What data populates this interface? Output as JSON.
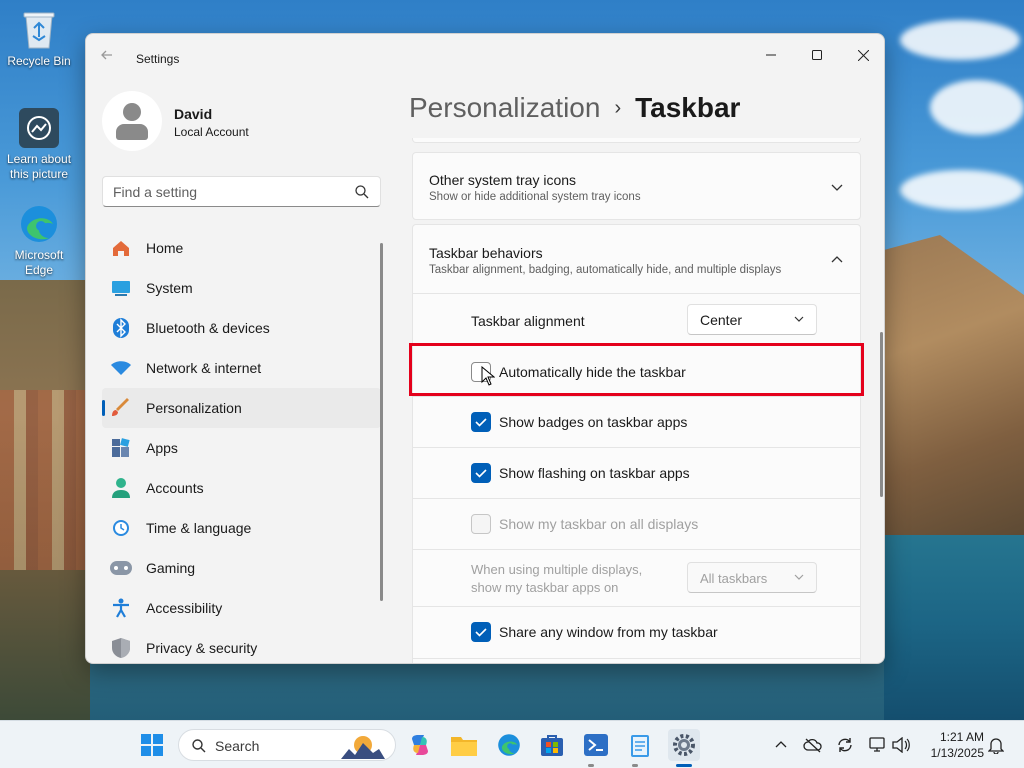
{
  "desktop": {
    "icons": [
      {
        "label": "Recycle Bin"
      },
      {
        "label": "Learn about this picture"
      },
      {
        "label": "Microsoft Edge"
      }
    ]
  },
  "window": {
    "title": "Settings",
    "profile": {
      "name": "David",
      "account": "Local Account"
    },
    "search": {
      "placeholder": "Find a setting"
    },
    "nav": [
      {
        "label": "Home",
        "icon": "home-icon"
      },
      {
        "label": "System",
        "icon": "system-icon"
      },
      {
        "label": "Bluetooth & devices",
        "icon": "bluetooth-icon"
      },
      {
        "label": "Network & internet",
        "icon": "wifi-icon"
      },
      {
        "label": "Personalization",
        "icon": "brush-icon",
        "active": true
      },
      {
        "label": "Apps",
        "icon": "apps-icon"
      },
      {
        "label": "Accounts",
        "icon": "accounts-icon"
      },
      {
        "label": "Time & language",
        "icon": "clock-icon"
      },
      {
        "label": "Gaming",
        "icon": "gamepad-icon"
      },
      {
        "label": "Accessibility",
        "icon": "accessibility-icon"
      },
      {
        "label": "Privacy & security",
        "icon": "shield-icon"
      }
    ],
    "breadcrumb": {
      "parent": "Personalization",
      "separator": "›",
      "current": "Taskbar"
    },
    "sections": {
      "tray": {
        "title": "Other system tray icons",
        "subtitle": "Show or hide additional system tray icons"
      },
      "behaviors": {
        "title": "Taskbar behaviors",
        "subtitle": "Taskbar alignment, badging, automatically hide, and multiple displays"
      }
    },
    "alignment": {
      "label": "Taskbar alignment",
      "value": "Center"
    },
    "options": {
      "autohide": {
        "label": "Automatically hide the taskbar",
        "checked": false
      },
      "badges": {
        "label": "Show badges on taskbar apps",
        "checked": true
      },
      "flashing": {
        "label": "Show flashing on taskbar apps",
        "checked": true
      },
      "all_displays": {
        "label": "Show my taskbar on all displays",
        "checked": false,
        "disabled": true
      },
      "multi_display": {
        "label_line1": "When using multiple displays,",
        "label_line2": "show my taskbar apps on",
        "value": "All taskbars"
      },
      "share": {
        "label": "Share any window from my taskbar",
        "checked": true
      }
    }
  },
  "taskbar": {
    "search_label": "Search",
    "time": "1:21 AM",
    "date": "1/13/2025"
  },
  "colors": {
    "accent": "#005fb8",
    "highlight": "#e4001b"
  }
}
